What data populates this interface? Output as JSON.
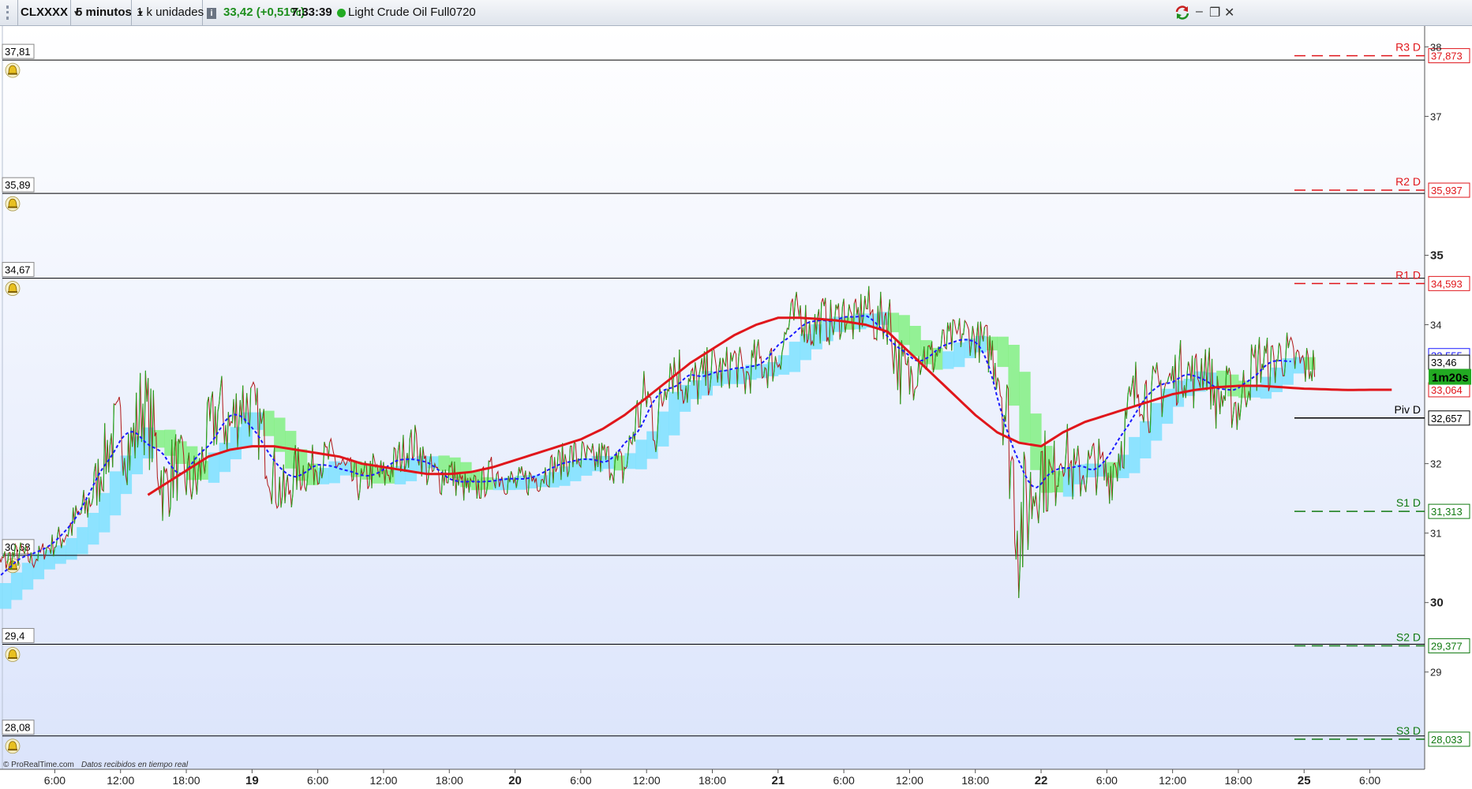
{
  "toolbar": {
    "symbol": "CLXXXX",
    "timeframe": "5 minutos",
    "units": "1 k unidades",
    "info_icon": "info-icon",
    "price": "33,42 (+0,51%)",
    "time": "7:33:39",
    "status_color": "#22aa22",
    "instrument": "Light Crude Oil Full0720",
    "sync_icon": "sync-arrows-icon",
    "minimize": "–",
    "restore": "❐",
    "close": "✕"
  },
  "colors": {
    "candle_up": "#22aa22",
    "candle_down": "#b01818",
    "sma": "#e0161b",
    "fast_ma": "#1a1aff",
    "cloud_bull": "#7de0ff",
    "cloud_bear": "#82f082",
    "pivot_res": "#e0161b",
    "pivot_sup": "#117a11",
    "bg_top": "#ffffff",
    "bg_bottom": "#dbe4fb"
  },
  "footer": {
    "copyright": "© ProRealTime.com",
    "note": "Datos recibidos en tiempo real"
  },
  "chart_data": {
    "type": "line",
    "title": "Light Crude Oil Full0720",
    "timeframe": "5 minutos",
    "ylim": [
      27.6,
      38.3
    ],
    "x_ticks": [
      {
        "t": 6,
        "label": "6:00",
        "bold": false
      },
      {
        "t": 12,
        "label": "12:00",
        "bold": false
      },
      {
        "t": 18,
        "label": "18:00",
        "bold": false
      },
      {
        "t": 24,
        "label": "19",
        "bold": true
      },
      {
        "t": 30,
        "label": "6:00",
        "bold": false
      },
      {
        "t": 36,
        "label": "12:00",
        "bold": false
      },
      {
        "t": 42,
        "label": "18:00",
        "bold": false
      },
      {
        "t": 48,
        "label": "20",
        "bold": true
      },
      {
        "t": 54,
        "label": "6:00",
        "bold": false
      },
      {
        "t": 60,
        "label": "12:00",
        "bold": false
      },
      {
        "t": 66,
        "label": "18:00",
        "bold": false
      },
      {
        "t": 72,
        "label": "21",
        "bold": true
      },
      {
        "t": 78,
        "label": "6:00",
        "bold": false
      },
      {
        "t": 84,
        "label": "12:00",
        "bold": false
      },
      {
        "t": 90,
        "label": "18:00",
        "bold": false
      },
      {
        "t": 96,
        "label": "22",
        "bold": true
      },
      {
        "t": 102,
        "label": "6:00",
        "bold": false
      },
      {
        "t": 108,
        "label": "12:00",
        "bold": false
      },
      {
        "t": 114,
        "label": "18:00",
        "bold": false
      },
      {
        "t": 120,
        "label": "25",
        "bold": true
      },
      {
        "t": 126,
        "label": "6:00",
        "bold": false
      }
    ],
    "y_ticks": [
      {
        "v": 38,
        "label": "38",
        "bold": false
      },
      {
        "v": 37,
        "label": "37",
        "bold": false
      },
      {
        "v": 35,
        "label": "35",
        "bold": true
      },
      {
        "v": 34,
        "label": "34",
        "bold": false
      },
      {
        "v": 32,
        "label": "32",
        "bold": false
      },
      {
        "v": 31,
        "label": "31",
        "bold": false
      },
      {
        "v": 30,
        "label": "30",
        "bold": true
      },
      {
        "v": 29,
        "label": "29",
        "bold": false
      }
    ],
    "alert_lines": [
      {
        "label": "37,81",
        "value": 37.81
      },
      {
        "label": "35,89",
        "value": 35.89
      },
      {
        "label": "34,67",
        "value": 34.67
      },
      {
        "label": "30,68",
        "value": 30.68
      },
      {
        "label": "29,4",
        "value": 29.4
      },
      {
        "label": "28,08",
        "value": 28.08
      }
    ],
    "pivots": [
      {
        "name": "R3 D",
        "label": "37,873",
        "value": 37.873,
        "kind": "res"
      },
      {
        "name": "R2 D",
        "label": "35,937",
        "value": 35.937,
        "kind": "res"
      },
      {
        "name": "R1 D",
        "label": "34,593",
        "value": 34.593,
        "kind": "res"
      },
      {
        "name": "Piv D",
        "label": "32,657",
        "value": 32.657,
        "kind": "piv"
      },
      {
        "name": "S1 D",
        "label": "31,313",
        "value": 31.313,
        "kind": "sup"
      },
      {
        "name": "S2 D",
        "label": "29,377",
        "value": 29.377,
        "kind": "sup"
      },
      {
        "name": "S3 D",
        "label": "28,033",
        "value": 28.033,
        "kind": "sup"
      }
    ],
    "price_tags": [
      {
        "label": "33,555",
        "value": 33.555,
        "color": "#1a1aff"
      },
      {
        "label": "33,46",
        "value": 33.46,
        "color": "#000000"
      },
      {
        "label": "33,064",
        "value": 33.064,
        "color": "#e0161b"
      }
    ],
    "countdown": "1m20s",
    "price_series": {
      "t": [
        0,
        1,
        2,
        3,
        4,
        5,
        6,
        7,
        8,
        9,
        10,
        11,
        12,
        13,
        14,
        15,
        16,
        17,
        18,
        19,
        20,
        21,
        22,
        23,
        24,
        25,
        26,
        27,
        28,
        29,
        30,
        31,
        32,
        33,
        34,
        35,
        36,
        37,
        38,
        39,
        40,
        41,
        42,
        43,
        44,
        45,
        46,
        47,
        48,
        49,
        50,
        51,
        52,
        53,
        54,
        55,
        56,
        57,
        58,
        59,
        60,
        61,
        62,
        63,
        64,
        65,
        66,
        67,
        68,
        69,
        70,
        71,
        72,
        73,
        74,
        75,
        76,
        77,
        78,
        79,
        80,
        81,
        82,
        83,
        84,
        85,
        86,
        87,
        88,
        89,
        90,
        91,
        92,
        93,
        94,
        95,
        96,
        97,
        98,
        99,
        100,
        101,
        102,
        103,
        104,
        105,
        106,
        107,
        108,
        109,
        110,
        111,
        112,
        113,
        114,
        115,
        116,
        117,
        118,
        119,
        120,
        121,
        122,
        123,
        124,
        125,
        126,
        127,
        128
      ],
      "close": [
        30.0,
        30.55,
        30.65,
        30.7,
        30.6,
        30.75,
        30.85,
        31.0,
        31.2,
        31.4,
        31.8,
        32.3,
        32.5,
        32.2,
        32.9,
        32.4,
        31.6,
        32.0,
        31.8,
        31.7,
        32.4,
        32.8,
        32.5,
        32.9,
        32.8,
        32.4,
        31.8,
        31.5,
        31.9,
        31.9,
        32.0,
        32.1,
        32.0,
        31.8,
        31.7,
        31.9,
        31.8,
        32.0,
        32.2,
        32.3,
        31.9,
        31.8,
        31.9,
        31.7,
        31.6,
        31.7,
        31.9,
        31.8,
        31.7,
        31.75,
        31.8,
        31.9,
        32.0,
        32.1,
        32.1,
        32.0,
        32.1,
        32.0,
        31.9,
        32.6,
        33.0,
        32.5,
        33.5,
        33.3,
        33.1,
        33.2,
        33.4,
        33.3,
        33.5,
        33.2,
        33.5,
        33.4,
        33.5,
        34.0,
        34.2,
        33.9,
        34.1,
        34.0,
        34.2,
        34.0,
        34.3,
        34.0,
        34.2,
        33.4,
        33.2,
        33.6,
        33.5,
        33.7,
        33.8,
        33.9,
        33.8,
        33.7,
        33.5,
        32.5,
        31.0,
        31.5,
        32.0,
        31.7,
        32.3,
        31.8,
        31.9,
        32.0,
        31.8,
        32.1,
        32.7,
        33.2,
        32.9,
        33.1,
        33.2,
        33.4,
        33.2,
        33.5,
        32.9,
        33.0,
        32.8,
        33.3,
        33.5,
        33.4,
        33.6,
        33.5,
        33.4,
        33.42
      ],
      "noise": [
        0.15,
        0.25,
        0.2,
        0.2,
        0.15,
        0.15,
        0.2,
        0.25,
        0.3,
        0.35,
        0.45,
        0.55,
        0.6,
        0.65,
        0.7,
        0.7,
        0.6,
        0.55,
        0.5,
        0.5,
        0.55,
        0.6,
        0.6,
        0.55,
        0.5,
        0.55,
        0.5,
        0.45,
        0.4,
        0.35,
        0.3,
        0.3,
        0.3,
        0.3,
        0.3,
        0.3,
        0.3,
        0.3,
        0.3,
        0.3,
        0.3,
        0.3,
        0.3,
        0.25,
        0.25,
        0.25,
        0.25,
        0.25,
        0.25,
        0.25,
        0.25,
        0.25,
        0.25,
        0.3,
        0.3,
        0.3,
        0.3,
        0.3,
        0.35,
        0.45,
        0.5,
        0.55,
        0.5,
        0.5,
        0.45,
        0.4,
        0.35,
        0.35,
        0.35,
        0.35,
        0.35,
        0.35,
        0.3,
        0.35,
        0.35,
        0.35,
        0.35,
        0.35,
        0.35,
        0.35,
        0.35,
        0.35,
        0.5,
        0.55,
        0.45,
        0.4,
        0.35,
        0.3,
        0.3,
        0.3,
        0.3,
        0.35,
        0.55,
        0.9,
        1.1,
        0.9,
        0.7,
        0.6,
        0.5,
        0.5,
        0.45,
        0.45,
        0.45,
        0.5,
        0.55,
        0.55,
        0.5,
        0.5,
        0.45,
        0.45,
        0.45,
        0.45,
        0.45,
        0.45,
        0.45,
        0.45,
        0.45,
        0.4,
        0.4,
        0.35,
        0.35,
        0.3
      ]
    },
    "sma_series": {
      "t": [
        0,
        2,
        4,
        6,
        8,
        10,
        12,
        14,
        16,
        18,
        20,
        22,
        24,
        26,
        28,
        30,
        32,
        34,
        36,
        38,
        40,
        42,
        44,
        46,
        48,
        50,
        52,
        54,
        56,
        58,
        60,
        62,
        64,
        66,
        68,
        70,
        72,
        74,
        76,
        78,
        80,
        82,
        84,
        86,
        88,
        90,
        92,
        94,
        96,
        98,
        100,
        102,
        104,
        106,
        108,
        110,
        112,
        114,
        116,
        118,
        120,
        122,
        124,
        126,
        128
      ],
      "values": [
        30.0,
        30.2,
        30.45,
        30.75,
        31.0,
        31.15,
        31.3,
        31.5,
        31.7,
        31.9,
        32.1,
        32.2,
        32.25,
        32.25,
        32.2,
        32.15,
        32.1,
        32.0,
        31.95,
        31.9,
        31.85,
        31.85,
        31.88,
        31.95,
        32.05,
        32.15,
        32.25,
        32.35,
        32.5,
        32.7,
        32.95,
        33.2,
        33.45,
        33.65,
        33.85,
        34.0,
        34.1,
        34.1,
        34.08,
        34.05,
        34.0,
        33.9,
        33.6,
        33.3,
        33.0,
        32.7,
        32.45,
        32.3,
        32.25,
        32.45,
        32.6,
        32.7,
        32.8,
        32.9,
        33.0,
        33.06,
        33.1,
        33.12,
        33.12,
        33.1,
        33.08,
        33.07,
        33.06,
        33.064,
        33.064
      ]
    }
  }
}
